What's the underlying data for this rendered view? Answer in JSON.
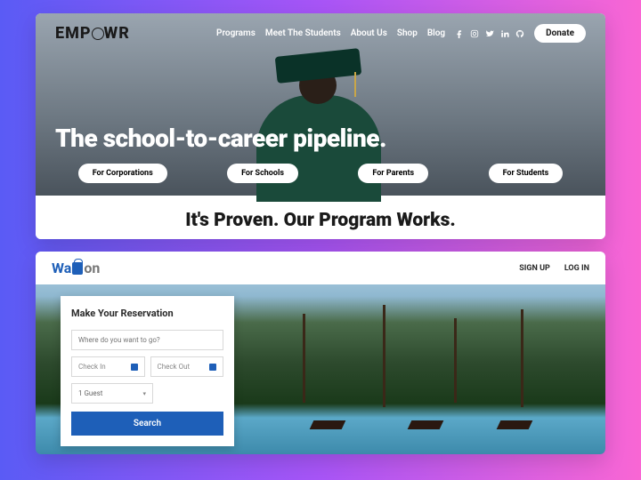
{
  "card1": {
    "logo_pre": "EMP",
    "logo_post": "WR",
    "nav": [
      "Programs",
      "Meet The Students",
      "About Us",
      "Shop",
      "Blog"
    ],
    "donate": "Donate",
    "tagline": "The school-to-career pipeline.",
    "buttons": [
      "For Corporations",
      "For Schools",
      "For Parents",
      "For Students"
    ],
    "subhead": "It's Proven. Our Program Works."
  },
  "card2": {
    "logo_pre": "Wa",
    "logo_post": "on",
    "auth": {
      "signup": "SIGN UP",
      "login": "LOG IN"
    },
    "form": {
      "title": "Make Your Reservation",
      "where_ph": "Where do you want to go?",
      "checkin": "Check In",
      "checkout": "Check Out",
      "guests": "1 Guest",
      "search": "Search"
    }
  }
}
